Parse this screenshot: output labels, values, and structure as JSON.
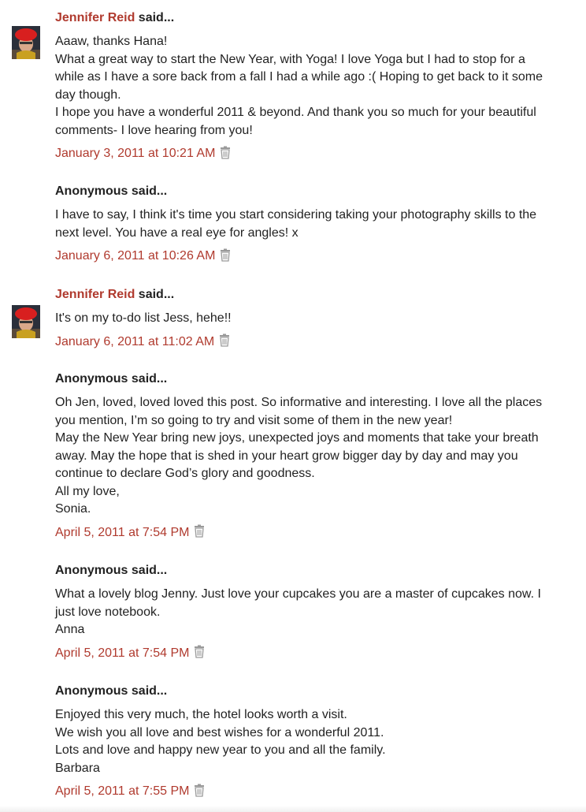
{
  "said_suffix": " said...",
  "comments": [
    {
      "author": "Jennifer Reid",
      "author_is_link": true,
      "has_avatar": true,
      "lines": [
        "Aaaw, thanks Hana!",
        "What a great way to start the New Year, with Yoga! I love Yoga but I had to stop for a",
        "while as I have a sore back from a fall I had a while ago :( Hoping to get back to it some",
        "day though.",
        "I hope you have a wonderful 2011 & beyond. And thank you so much for your beautiful",
        "comments- I love hearing from you!"
      ],
      "timestamp": "January 3, 2011 at 10:21 AM"
    },
    {
      "author": "Anonymous",
      "author_is_link": false,
      "has_avatar": false,
      "lines": [
        "I have to say, I think it's time you start considering taking your photography skills to the",
        "next level. You have a real eye for angles! x"
      ],
      "timestamp": "January 6, 2011 at 10:26 AM"
    },
    {
      "author": "Jennifer Reid",
      "author_is_link": true,
      "has_avatar": true,
      "lines": [
        "It's on my to-do list Jess, hehe!!"
      ],
      "timestamp": "January 6, 2011 at 11:02 AM"
    },
    {
      "author": "Anonymous",
      "author_is_link": false,
      "has_avatar": false,
      "lines": [
        "Oh Jen, loved, loved loved this post. So informative and interesting. I love all the places",
        "you mention, I’m so going to try and visit some of them in the new year!",
        "May the New Year bring new joys, unexpected joys and moments that take your breath",
        "away. May the hope that is shed in your heart grow bigger day by day and may you",
        "continue to declare God’s glory and goodness.",
        "All my love,",
        "Sonia."
      ],
      "timestamp": "April 5, 2011 at 7:54 PM"
    },
    {
      "author": "Anonymous",
      "author_is_link": false,
      "has_avatar": false,
      "lines": [
        "What a lovely blog Jenny. Just love your cupcakes you are a master of cupcakes now. I",
        "just love notebook.",
        "Anna"
      ],
      "timestamp": "April 5, 2011 at 7:54 PM"
    },
    {
      "author": "Anonymous",
      "author_is_link": false,
      "has_avatar": false,
      "lines": [
        "Enjoyed this very much, the hotel looks worth a visit.",
        "We wish you all love and best wishes for a wonderful 2011.",
        "Lots and love and happy new year to you and all the family.",
        "Barbara"
      ],
      "timestamp": "April 5, 2011 at 7:55 PM"
    }
  ],
  "colors": {
    "link": "#b03a2e",
    "text": "#222222",
    "trash_icon": "#9a9a9a"
  },
  "icons": {
    "delete": "trash-icon",
    "avatar": "avatar"
  }
}
